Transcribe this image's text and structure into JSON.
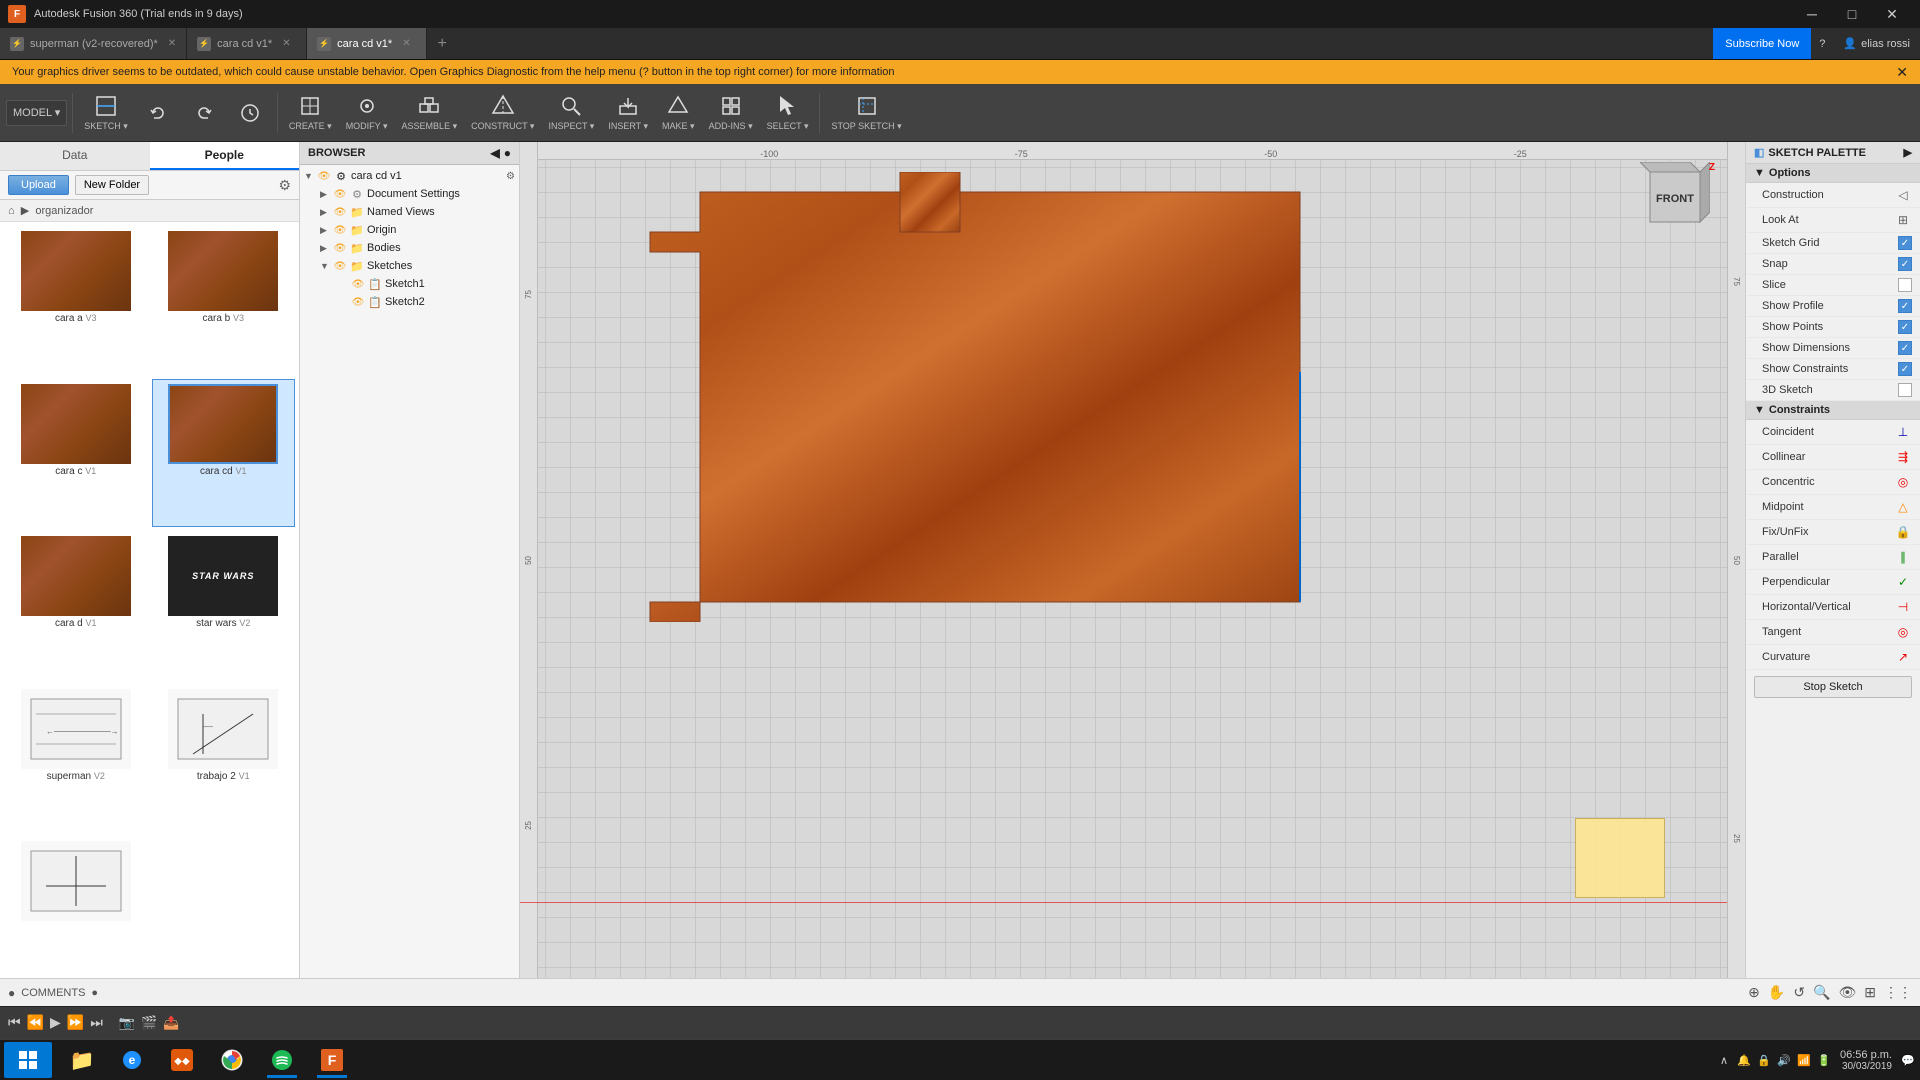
{
  "app": {
    "title": "Autodesk Fusion 360 (Trial ends in 9 days)",
    "icon": "F"
  },
  "titlebar": {
    "title": "Autodesk Fusion 360 (Trial ends in 9 days)",
    "minimize": "─",
    "maximize": "□",
    "close": "✕"
  },
  "tabs": [
    {
      "label": "superman (v2-recovered)*",
      "active": false,
      "closable": true
    },
    {
      "label": "cara cd v1*",
      "active": false,
      "closable": true
    },
    {
      "label": "cara cd v1*",
      "active": true,
      "closable": true
    }
  ],
  "subscribe": "Subscribe Now",
  "user": "elias rossi",
  "warnbar": "Your graphics driver seems to be outdated, which could cause unstable behavior. Open Graphics Diagnostic from the help menu (? button in the top right corner) for more information",
  "toolbar": {
    "mode_dropdown": "MODEL ▾",
    "sketch_label": "SKETCH ▾",
    "create_label": "CREATE ▾",
    "modify_label": "MODIFY ▾",
    "assemble_label": "ASSEMBLE ▾",
    "construct_label": "CONSTRUCT ▾",
    "inspect_label": "INSPECT ▾",
    "insert_label": "INSERT ▾",
    "make_label": "MAKE ▾",
    "addins_label": "ADD-INS ▾",
    "select_label": "SELECT ▾",
    "stop_sketch_label": "STOP SKETCH ▾"
  },
  "left_panel": {
    "data_tab": "Data",
    "people_tab": "People",
    "upload_btn": "Upload",
    "new_folder_btn": "New Folder",
    "folder_path": "organizador",
    "files": [
      {
        "name": "cara a",
        "version": "V3",
        "type": "wood"
      },
      {
        "name": "cara b",
        "version": "V3",
        "type": "wood"
      },
      {
        "name": "cara c",
        "version": "V1",
        "type": "wood"
      },
      {
        "name": "cara cd",
        "version": "V1",
        "type": "wood",
        "selected": true
      },
      {
        "name": "cara d",
        "version": "V1",
        "type": "wood"
      },
      {
        "name": "star wars",
        "version": "V2",
        "type": "dark"
      },
      {
        "name": "superman",
        "version": "V2",
        "type": "drawing"
      },
      {
        "name": "trabajo 2",
        "version": "V1",
        "type": "drawing"
      },
      {
        "name": "",
        "version": "",
        "type": "drawing"
      }
    ]
  },
  "browser": {
    "header": "BROWSER",
    "items": [
      {
        "indent": 0,
        "arrow": "▼",
        "label": "cara cd v1",
        "extra": "⚙",
        "level": 0
      },
      {
        "indent": 1,
        "arrow": "",
        "label": "Document Settings",
        "extra": "",
        "level": 1
      },
      {
        "indent": 1,
        "arrow": "▶",
        "label": "Named Views",
        "extra": "",
        "level": 1
      },
      {
        "indent": 1,
        "arrow": "▶",
        "label": "Origin",
        "extra": "",
        "level": 1
      },
      {
        "indent": 1,
        "arrow": "▶",
        "label": "Bodies",
        "extra": "",
        "level": 1
      },
      {
        "indent": 1,
        "arrow": "▼",
        "label": "Sketches",
        "extra": "",
        "level": 1
      },
      {
        "indent": 2,
        "arrow": "",
        "label": "Sketch1",
        "extra": "",
        "level": 2
      },
      {
        "indent": 2,
        "arrow": "",
        "label": "Sketch2",
        "extra": "",
        "level": 2
      }
    ]
  },
  "palette": {
    "header": "SKETCH PALETTE",
    "options_section": "Options",
    "options": [
      {
        "label": "Construction",
        "type": "icon",
        "icon": "◁",
        "checked": false
      },
      {
        "label": "Look At",
        "type": "icon",
        "icon": "⊞",
        "checked": false
      },
      {
        "label": "Sketch Grid",
        "type": "check",
        "checked": true
      },
      {
        "label": "Snap",
        "type": "check",
        "checked": true
      },
      {
        "label": "Slice",
        "type": "check",
        "checked": false
      },
      {
        "label": "Show Profile",
        "type": "check",
        "checked": true
      },
      {
        "label": "Show Points",
        "type": "check",
        "checked": true
      },
      {
        "label": "Show Dimensions",
        "type": "check",
        "checked": true
      },
      {
        "label": "Show Constraints",
        "type": "check",
        "checked": true
      },
      {
        "label": "3D Sketch",
        "type": "check",
        "checked": false
      }
    ],
    "constraints_section": "Constraints",
    "constraints": [
      {
        "label": "Coincident",
        "icon": "⊥",
        "color": "blue"
      },
      {
        "label": "Collinear",
        "icon": "⇶",
        "color": "red"
      },
      {
        "label": "Concentric",
        "icon": "◎",
        "color": "red"
      },
      {
        "label": "Midpoint",
        "icon": "△",
        "color": "orange"
      },
      {
        "label": "Fix/UnFix",
        "icon": "🔒",
        "color": "red"
      },
      {
        "label": "Parallel",
        "icon": "∥",
        "color": "green"
      },
      {
        "label": "Perpendicular",
        "icon": "✓",
        "color": "green"
      },
      {
        "label": "Horizontal/Vertical",
        "icon": "⊣",
        "color": "red"
      },
      {
        "label": "Tangent",
        "icon": "◎",
        "color": "red"
      },
      {
        "label": "Curvature",
        "icon": "↗",
        "color": "red"
      }
    ],
    "stop_sketch": "Stop Sketch"
  },
  "bottom": {
    "comments_label": "COMMENTS",
    "playback_controls": [
      "⏮",
      "⏪",
      "▶",
      "⏩",
      "⏭"
    ]
  },
  "ruler_labels": [
    "-100",
    "-75",
    "-50",
    "-25"
  ],
  "right_ruler": [
    "75",
    "50",
    "25"
  ],
  "view_cube_label": "FRONT",
  "taskbar": {
    "time": "06:56 p.m.",
    "date": "30/03/2019",
    "apps": [
      "⊞",
      "📁",
      "🌐",
      "🌀",
      "♪",
      "F"
    ]
  }
}
